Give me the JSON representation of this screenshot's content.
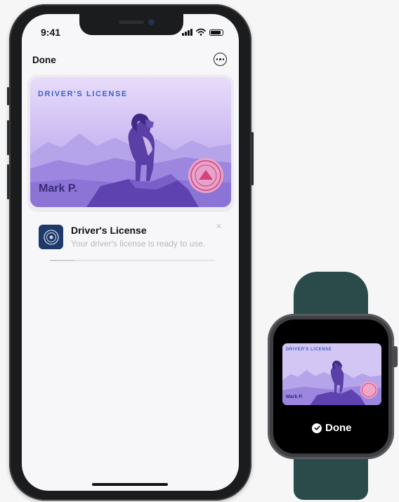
{
  "phone": {
    "status_time": "9:41",
    "nav": {
      "done_label": "Done"
    },
    "card": {
      "title": "DRIVER'S LICENSE",
      "holder_name": "Mark P."
    },
    "notification": {
      "title": "Driver's License",
      "body": "Your driver's license is ready to use.",
      "progress": 0.15
    }
  },
  "watch": {
    "card": {
      "title": "DRIVER'S LICENSE",
      "holder_name": "Mark P."
    },
    "done_label": "Done"
  },
  "icons": [
    "signal-icon",
    "wifi-icon",
    "battery-icon",
    "more-icon",
    "state-seal-icon",
    "close-icon",
    "checkmark-icon",
    "ram-illustration"
  ],
  "colors": {
    "card_accent": "#3a63c9",
    "card_text": "#3a2a78",
    "band": "#2b4a4a"
  }
}
